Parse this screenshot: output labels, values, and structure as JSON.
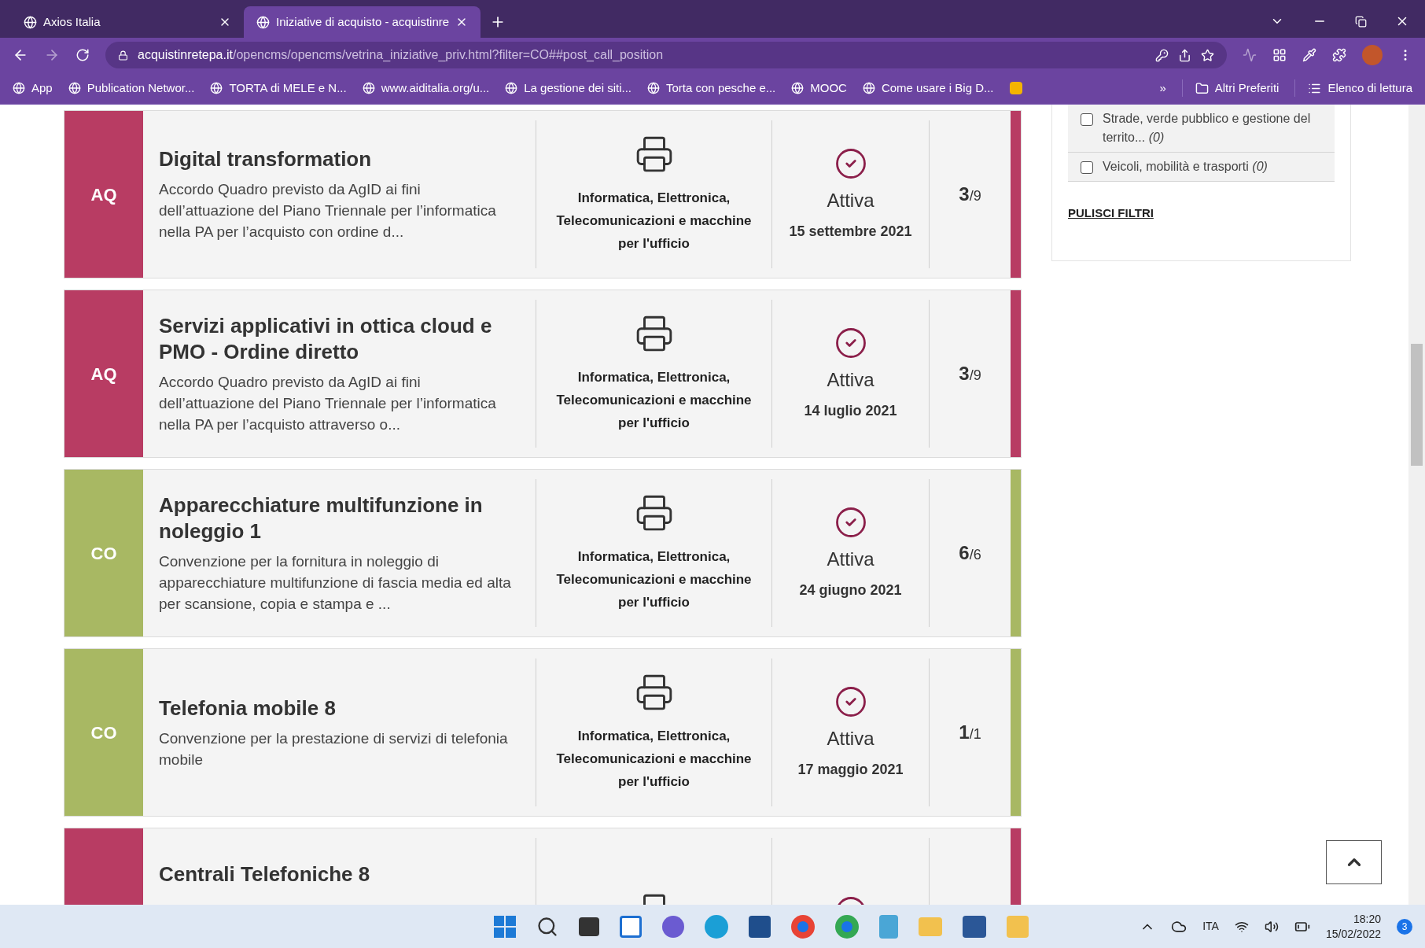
{
  "browser": {
    "tabs": [
      {
        "title": "Axios Italia",
        "selected": false
      },
      {
        "title": "Iniziative di acquisto - acquistinre",
        "selected": true
      }
    ],
    "url_host": "acquistinretepa.it",
    "url_path": "/opencms/opencms/vetrina_iniziative_priv.html?filter=CO##post_call_position",
    "bookmarks": [
      {
        "label": "App"
      },
      {
        "label": "Publication Networ..."
      },
      {
        "label": "TORTA di MELE e N..."
      },
      {
        "label": "www.aiditalia.org/u..."
      },
      {
        "label": "La gestione dei siti..."
      },
      {
        "label": "Torta con pesche e..."
      },
      {
        "label": "MOOC"
      },
      {
        "label": "Come usare i Big D..."
      }
    ],
    "more_bookmarks": "»",
    "other_bookmarks": "Altri Preferiti",
    "reading_list": "Elenco di lettura"
  },
  "cards": [
    {
      "badge": "AQ",
      "color": "#b83c63",
      "title": "Digital transformation",
      "description": "Accordo Quadro previsto da AgID ai fini dell’attuazione del Piano Triennale per l’informatica nella PA per l’acquisto con ordine d...",
      "category": "Informatica, Elettronica, Telecomunicazioni e macchine per l'ufficio",
      "status": "Attiva",
      "date": "15 settembre 2021",
      "count": "3",
      "total": "/9"
    },
    {
      "badge": "AQ",
      "color": "#b83c63",
      "title": "Servizi applicativi in ottica cloud e PMO - Ordine diretto",
      "description": "Accordo Quadro previsto da AgID ai fini dell’attuazione del Piano Triennale per l’informatica nella PA per l’acquisto attraverso o...",
      "category": "Informatica, Elettronica, Telecomunicazioni e macchine per l'ufficio",
      "status": "Attiva",
      "date": "14 luglio 2021",
      "count": "3",
      "total": "/9"
    },
    {
      "badge": "CO",
      "color": "#a8b863",
      "title": "Apparecchiature multifunzione in noleggio 1",
      "description": "Convenzione per la fornitura in noleggio di apparecchiature multifunzione di fascia media ed alta per scansione, copia e stampa e ...",
      "category": "Informatica, Elettronica, Telecomunicazioni e macchine per l'ufficio",
      "status": "Attiva",
      "date": "24 giugno 2021",
      "count": "6",
      "total": "/6"
    },
    {
      "badge": "CO",
      "color": "#a8b863",
      "title": "Telefonia mobile 8",
      "description": "Convenzione per la prestazione di servizi di telefonia mobile",
      "category": "Informatica, Elettronica, Telecomunicazioni e macchine per l'ufficio",
      "status": "Attiva",
      "date": "17 maggio 2021",
      "count": "1",
      "total": "/1"
    },
    {
      "color": "#b83c63",
      "title": "Centrali Telefoniche 8"
    }
  ],
  "filters": [
    {
      "label": "Strade, verde pubblico e gestione del territo... *(0)*",
      "checked": false
    },
    {
      "label": "Veicoli, mobilità e trasporti *(0)*",
      "checked": false
    }
  ],
  "clear_filters": "PULISCI FILTRI",
  "taskbar": {
    "language": "ITA",
    "time": "18:20",
    "date": "15/02/2022",
    "notifications": "3"
  }
}
